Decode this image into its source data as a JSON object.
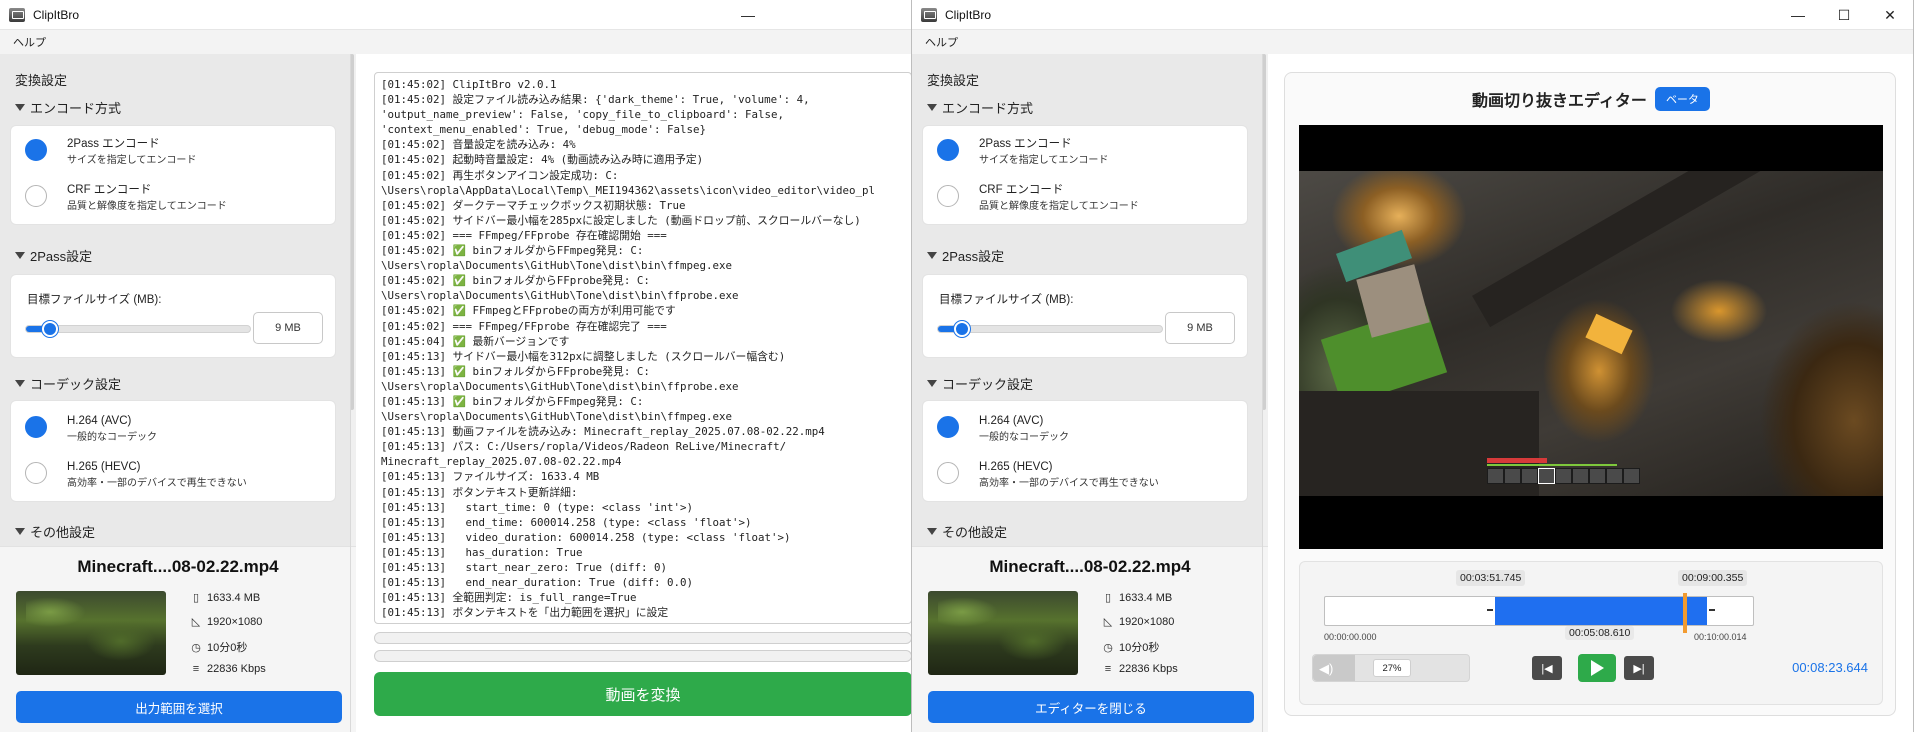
{
  "left_window": {
    "title": "ClipItBro",
    "menu": [
      "ヘルプ"
    ],
    "sidebar": {
      "title": "変換設定",
      "encode": {
        "header": "エンコード方式",
        "options": [
          {
            "label": "2Pass エンコード",
            "sub": "サイズを指定してエンコード",
            "selected": true
          },
          {
            "label": "CRF エンコード",
            "sub": "品質と解像度を指定してエンコード",
            "selected": false
          }
        ]
      },
      "twopass": {
        "header": "2Pass設定",
        "size_label": "目標ファイルサイズ (MB):",
        "value": "9 MB",
        "slider_fraction": 0.1
      },
      "codec": {
        "header": "コーデック設定",
        "options": [
          {
            "label": "H.264 (AVC)",
            "sub": "一般的なコーデック",
            "selected": true
          },
          {
            "label": "H.265 (HEVC)",
            "sub": "高効率・一部のデバイスで再生できない",
            "selected": false
          }
        ]
      },
      "other": {
        "header": "その他設定"
      }
    },
    "file": {
      "name": "Minecraft....08-02.22.mp4",
      "size": "1633.4 MB",
      "resolution": "1920×1080",
      "duration": "10分0秒",
      "bitrate": "22836 Kbps",
      "select_button": "出力範囲を選択"
    },
    "log_lines": [
      "[01:45:02] ClipItBro v2.0.1",
      "[01:45:02] 設定ファイル読み込み結果: {'dark_theme': True, 'volume': 4,",
      "'output_name_preview': False, 'copy_file_to_clipboard': False,",
      "'context_menu_enabled': True, 'debug_mode': False}",
      "[01:45:02] 音量設定を読み込み: 4%",
      "[01:45:02] 起動時音量設定: 4% (動画読み込み時に適用予定)",
      "[01:45:02] 再生ボタンアイコン設定成功: C:",
      "\\Users\\ropla\\AppData\\Local\\Temp\\_MEI194362\\assets\\icon\\video_editor\\video_pl",
      "[01:45:02] ダークテーマチェックボックス初期状態: True",
      "[01:45:02] サイドバー最小幅を285pxに設定しました (動画ドロップ前、スクロールバーなし)",
      "[01:45:02] === FFmpeg/FFprobe 存在確認開始 ===",
      "[01:45:02] ✅ binフォルダからFFmpeg発見: C:",
      "\\Users\\ropla\\Documents\\GitHub\\Tone\\dist\\bin\\ffmpeg.exe",
      "[01:45:02] ✅ binフォルダからFFprobe発見: C:",
      "\\Users\\ropla\\Documents\\GitHub\\Tone\\dist\\bin\\ffprobe.exe",
      "[01:45:02] ✅ FFmpegとFFprobeの両方が利用可能です",
      "[01:45:02] === FFmpeg/FFprobe 存在確認完了 ===",
      "[01:45:04] ✅ 最新バージョンです",
      "[01:45:13] サイドバー最小幅を312pxに調整しました (スクロールバー幅含む)",
      "[01:45:13] ✅ binフォルダからFFprobe発見: C:",
      "\\Users\\ropla\\Documents\\GitHub\\Tone\\dist\\bin\\ffprobe.exe",
      "[01:45:13] ✅ binフォルダからFFmpeg発見: C:",
      "\\Users\\ropla\\Documents\\GitHub\\Tone\\dist\\bin\\ffmpeg.exe",
      "[01:45:13] 動画ファイルを読み込み: Minecraft_replay_2025.07.08-02.22.mp4",
      "[01:45:13] パス: C:/Users/ropla/Videos/Radeon ReLive/Minecraft/",
      "Minecraft_replay_2025.07.08-02.22.mp4",
      "[01:45:13] ファイルサイズ: 1633.4 MB",
      "[01:45:13] ボタンテキスト更新詳細:",
      "[01:45:13]   start_time: 0 (type: <class 'int'>)",
      "[01:45:13]   end_time: 600014.258 (type: <class 'float'>)",
      "[01:45:13]   video_duration: 600014.258 (type: <class 'float'>)",
      "[01:45:13]   has_duration: True",
      "[01:45:13]   start_near_zero: True (diff: 0)",
      "[01:45:13]   end_near_duration: True (diff: 0.0)",
      "[01:45:13] 全範囲判定: is_full_range=True",
      "[01:45:13] ボタンテキストを「出力範囲を選択」に設定"
    ],
    "convert_button": "動画を変換"
  },
  "right_window": {
    "title": "ClipItBro",
    "menu": [
      "ヘルプ"
    ],
    "sidebar": {
      "title": "変換設定",
      "encode": {
        "header": "エンコード方式",
        "options": [
          {
            "label": "2Pass エンコード",
            "sub": "サイズを指定してエンコード",
            "selected": true
          },
          {
            "label": "CRF エンコード",
            "sub": "品質と解像度を指定してエンコード",
            "selected": false
          }
        ]
      },
      "twopass": {
        "header": "2Pass設定",
        "size_label": "目標ファイルサイズ (MB):",
        "value": "9 MB",
        "slider_fraction": 0.1
      },
      "codec": {
        "header": "コーデック設定",
        "options": [
          {
            "label": "H.264 (AVC)",
            "sub": "一般的なコーデック",
            "selected": true
          },
          {
            "label": "H.265 (HEVC)",
            "sub": "高効率・一部のデバイスで再生できない",
            "selected": false
          }
        ]
      },
      "other": {
        "header": "その他設定"
      }
    },
    "file": {
      "name": "Minecraft....08-02.22.mp4",
      "size": "1633.4 MB",
      "resolution": "1920×1080",
      "duration": "10分0秒",
      "bitrate": "22836 Kbps",
      "close_button": "エディターを閉じる"
    },
    "editor": {
      "title": "動画切り抜きエディター",
      "badge": "ベータ",
      "start_tag": "00:03:51.745",
      "end_tag": "00:09:00.355",
      "range_start": "00:00:00.000",
      "range_end": "00:10:00.014",
      "selection_length": "00:05:08.610",
      "volume": "27%",
      "current_time": "00:08:23.644"
    }
  }
}
